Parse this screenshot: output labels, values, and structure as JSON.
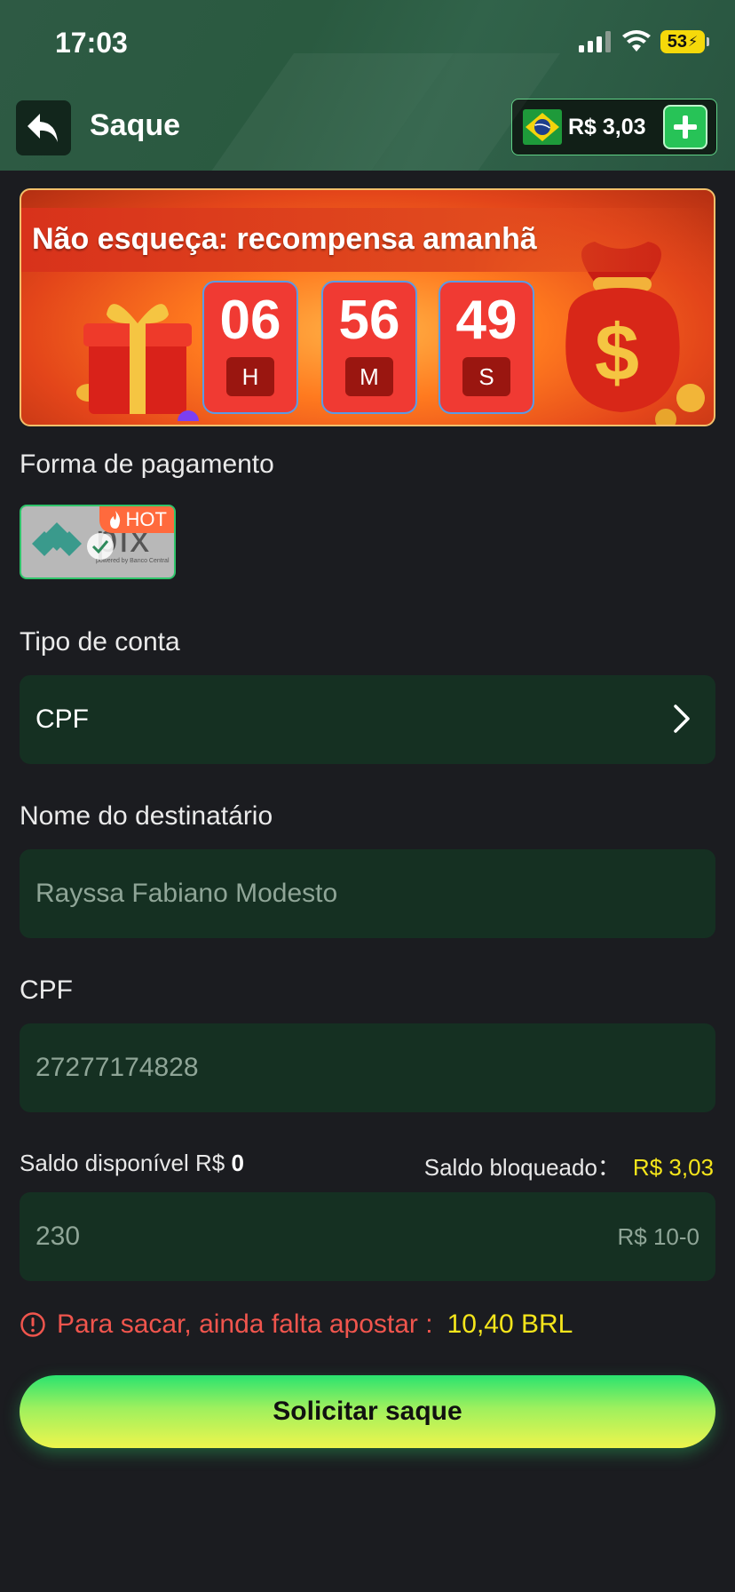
{
  "status_bar": {
    "time": "17:03",
    "battery": "53"
  },
  "header": {
    "title": "Saque",
    "balance": "R$ 3,03"
  },
  "banner": {
    "title": "Não esqueça: recompensa amanhã",
    "timer": [
      {
        "value": "06",
        "unit": "H"
      },
      {
        "value": "56",
        "unit": "M"
      },
      {
        "value": "49",
        "unit": "S"
      }
    ]
  },
  "payment": {
    "label": "Forma de pagamento",
    "method": "pix",
    "method_sub": "powered by Banco Central",
    "badge": "HOT"
  },
  "account_type": {
    "label": "Tipo de conta",
    "value": "CPF"
  },
  "recipient": {
    "label": "Nome do destinatário",
    "placeholder": "Rayssa Fabiano Modesto"
  },
  "cpf": {
    "label": "CPF",
    "placeholder": "27277174828"
  },
  "saldo": {
    "available_label": "Saldo disponível R$ ",
    "available_value": "0",
    "blocked_label": "Saldo bloqueado：",
    "blocked_value": "R$ 3,03"
  },
  "amount": {
    "placeholder": "230",
    "range_hint": "R$ 10-0"
  },
  "warning": {
    "text": "Para sacar, ainda falta apostar :",
    "amount": "10,40 BRL"
  },
  "submit": {
    "label": "Solicitar saque"
  },
  "colors": {
    "accent_green": "#27c357",
    "warning_red": "#f0554d",
    "highlight_yellow": "#f5e51b",
    "field_bg": "#153022"
  }
}
